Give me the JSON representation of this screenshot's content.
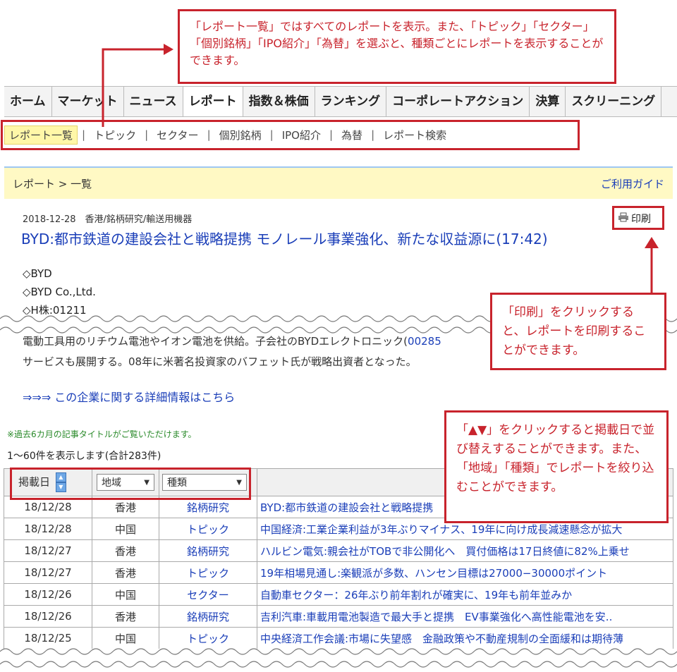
{
  "top_callout": "「レポート一覧」ではすべてのレポートを表示。また、「トピック」「セクター」「個別銘柄」「IPO紹介」「為替」を選ぶと、種類ごとにレポートを表示することができます。",
  "main_nav": [
    "ホーム",
    "マーケット",
    "ニュース",
    "レポート",
    "指数＆株価",
    "ランキング",
    "コーポレートアクション",
    "決算",
    "スクリーニング"
  ],
  "sub_nav": [
    "レポート一覧",
    "トピック",
    "セクター",
    "個別銘柄",
    "IPO紹介",
    "為替",
    "レポート検索"
  ],
  "breadcrumb": "レポート > 一覧",
  "guide_link": "ご利用ガイド",
  "article": {
    "date_category": "2018-12-28　香港/銘柄研究/輸送用機器",
    "print_label": "印刷",
    "title": "BYD:都市鉄道の建設会社と戦略提携 モノレール事業強化、新たな収益源に(17:42)",
    "codes": [
      "◇BYD",
      "◇BYD Co.,Ltd.",
      "◇H株:01211"
    ],
    "desc_line1": "電動工具用のリチウム電池やイオン電池を供給。子会社のBYDエレクトロニック(",
    "desc_code": "00285",
    "desc_line2": "サービスも展開する。08年に米著名投資家のバフェット氏が戦略出資者となった。",
    "detail_link": "⇒⇒⇒ この企業に関する詳細情報はこちら"
  },
  "print_callout": "「印刷」をクリックすると、レポートを印刷することができます。",
  "note": "※過去6カ月の記事タイトルがご覧いただけます。",
  "count_text": "1〜60件を表示します(合計283件)",
  "table": {
    "header": {
      "date": "掲載日",
      "region_select": "地域",
      "type_select": "種類"
    },
    "rows": [
      {
        "date": "18/12/28",
        "region": "香港",
        "type": "銘柄研究",
        "title": "BYD:都市鉄道の建設会社と戦略提携"
      },
      {
        "date": "18/12/28",
        "region": "中国",
        "type": "トピック",
        "title": "中国経済:工業企業利益が3年ぶりマイナス、19年に向け成長減速懸念が拡大"
      },
      {
        "date": "18/12/27",
        "region": "香港",
        "type": "銘柄研究",
        "title": "ハルビン電気:親会社がTOBで非公開化へ　買付価格は17日終値に82%上乗せ"
      },
      {
        "date": "18/12/27",
        "region": "香港",
        "type": "トピック",
        "title": "19年相場見通し:楽観派が多数、ハンセン目標は27000−30000ポイント"
      },
      {
        "date": "18/12/26",
        "region": "中国",
        "type": "セクター",
        "title": "自動車セクター：26年ぶり前年割れが確実に、19年も前年並みか"
      },
      {
        "date": "18/12/26",
        "region": "香港",
        "type": "銘柄研究",
        "title": "吉利汽車:車載用電池製造で最大手と提携　EV事業強化へ高性能電池を安.."
      },
      {
        "date": "18/12/25",
        "region": "中国",
        "type": "トピック",
        "title": "中央経済工作会議:市場に失望感　金融政策や不動産規制の全面緩和は期待薄"
      }
    ]
  },
  "sort_callout": "「▲▼」をクリックすると掲載日で並び替えすることができます。また、「地域」「種類」でレポートを絞り込むことができます。",
  "colors": {
    "accent_red": "#c8232c",
    "link_blue": "#1a3eb8",
    "highlight_yellow": "#fff9c4"
  }
}
